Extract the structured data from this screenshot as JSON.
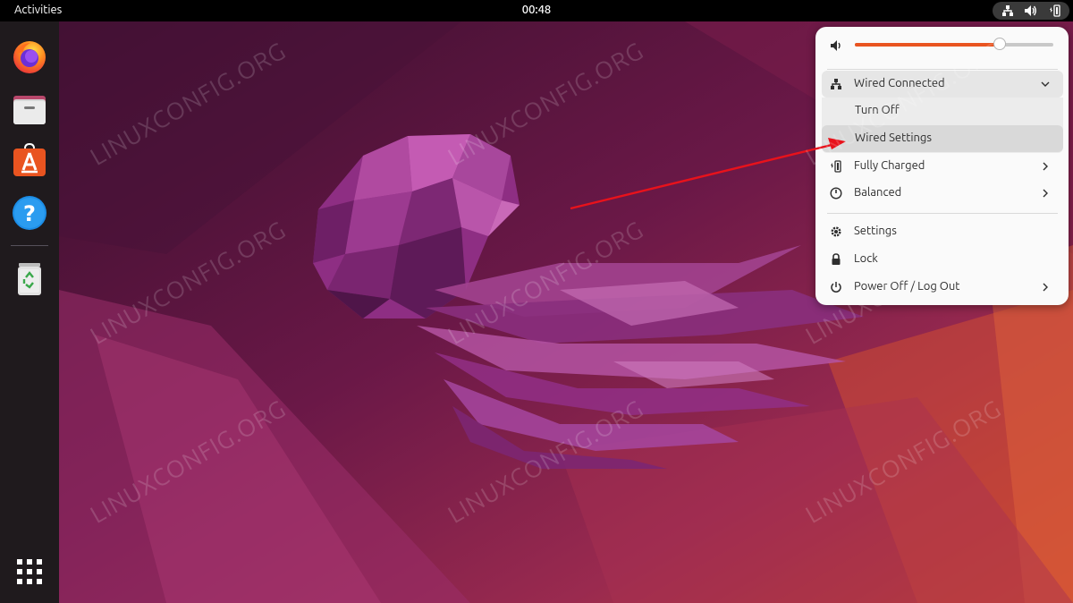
{
  "topbar": {
    "activities_label": "Activities",
    "clock": "00:48",
    "tray_icons": [
      "network-wired-icon",
      "volume-icon",
      "battery-icon"
    ]
  },
  "dock": {
    "apps": [
      {
        "name": "Firefox",
        "icon": "firefox-icon"
      },
      {
        "name": "Files",
        "icon": "files-icon"
      },
      {
        "name": "Ubuntu Software",
        "icon": "software-icon"
      },
      {
        "name": "Help",
        "icon": "help-icon"
      },
      {
        "name": "Trash",
        "icon": "trash-icon"
      },
      {
        "name": "Show Applications",
        "icon": "app-grid-icon"
      }
    ]
  },
  "watermark": "LINUXCONFIG.ORG",
  "quick_menu": {
    "volume": {
      "level": 0.73,
      "icon": "volume-icon"
    },
    "network": {
      "label": "Wired Connected",
      "icon": "network-wired-icon",
      "expanded": true,
      "submenu": [
        "Turn Off",
        "Wired Settings"
      ],
      "highlighted": "Wired Settings"
    },
    "battery": {
      "label": "Fully Charged",
      "icon": "battery-icon"
    },
    "power_mode": {
      "label": "Balanced",
      "icon": "power-profile-icon"
    },
    "settings": {
      "label": "Settings",
      "icon": "gear-icon"
    },
    "lock": {
      "label": "Lock",
      "icon": "lock-icon"
    },
    "power": {
      "label": "Power Off / Log Out",
      "icon": "power-icon"
    }
  },
  "colors": {
    "accent": "#e95420",
    "topbar": "#000000",
    "dock": "#1f1a1d",
    "annotation_arrow": "#e8121b"
  }
}
